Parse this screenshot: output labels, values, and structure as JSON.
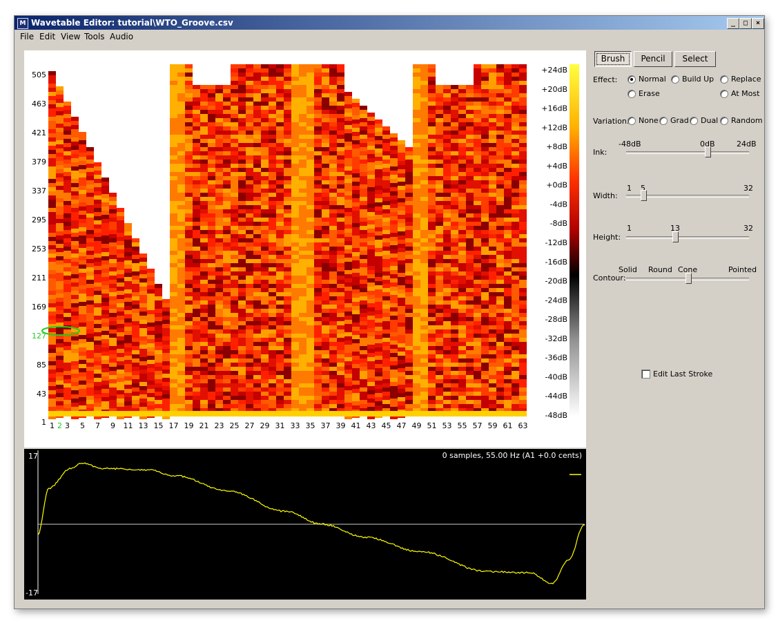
{
  "window": {
    "title": "Wavetable Editor: tutorial\\WTO_Groove.csv",
    "app_icon": "M",
    "controls": {
      "minimize": "_",
      "maximize": "□",
      "close": "×"
    }
  },
  "menu": [
    "File",
    "Edit",
    "View",
    "Tools",
    "Audio"
  ],
  "spectrogram": {
    "y_labels": [
      "505",
      "463",
      "421",
      "379",
      "337",
      "295",
      "253",
      "211",
      "169",
      "127",
      "85",
      "43",
      "1"
    ],
    "highlighted_y_label": "127",
    "x_labels": [
      "1",
      "2",
      "3",
      "5",
      "7",
      "9",
      "11",
      "13",
      "15",
      "17",
      "19",
      "21",
      "23",
      "25",
      "27",
      "29",
      "31",
      "33",
      "35",
      "37",
      "39",
      "41",
      "43",
      "45",
      "47",
      "49",
      "51",
      "53",
      "55",
      "57",
      "59",
      "61",
      "63"
    ],
    "highlighted_x_label": "2",
    "colorbar_labels": [
      "+24dB",
      "+20dB",
      "+16dB",
      "+12dB",
      "+8dB",
      "+4dB",
      "+0dB",
      "-4dB",
      "-8dB",
      "-12dB",
      "-16dB",
      "-20dB",
      "-24dB",
      "-28dB",
      "-32dB",
      "-36dB",
      "-40dB",
      "-44dB",
      "-48dB"
    ],
    "colors": {
      "hot": "#ff2200",
      "warm": "#ff8a00",
      "peak": "#ffee00",
      "cold": "#000000",
      "empty": "#ffffff",
      "marker": "#22cc22"
    }
  },
  "waveform": {
    "info": "0 samples, 55.00 Hz (A1 +0.0 cents)",
    "y_max": "17",
    "y_min": "-17",
    "line_color": "#ffff00"
  },
  "tools": {
    "buttons": [
      "Brush",
      "Pencil",
      "Select"
    ],
    "active": "Brush",
    "effect": {
      "label": "Effect:",
      "options": [
        "Normal",
        "Build Up",
        "Replace",
        "Erase",
        "At Most"
      ],
      "selected": "Normal"
    },
    "variation": {
      "label": "Variation:",
      "options": [
        "None",
        "Grad",
        "Dual",
        "Random"
      ]
    },
    "ink": {
      "label": "Ink:",
      "min": "-48dB",
      "mid": "0dB",
      "max": "24dB",
      "value_db": 0
    },
    "width": {
      "label": "Width:",
      "min": "1",
      "max": "32",
      "value": "5"
    },
    "height": {
      "label": "Height:",
      "min": "1",
      "max": "32",
      "value": "13"
    },
    "contour": {
      "label": "Contour:",
      "options": [
        "Solid",
        "Round",
        "Cone",
        "Pointed"
      ],
      "level": 0.5
    },
    "edit_last_stroke": {
      "label": "Edit Last Stroke",
      "checked": false
    }
  }
}
